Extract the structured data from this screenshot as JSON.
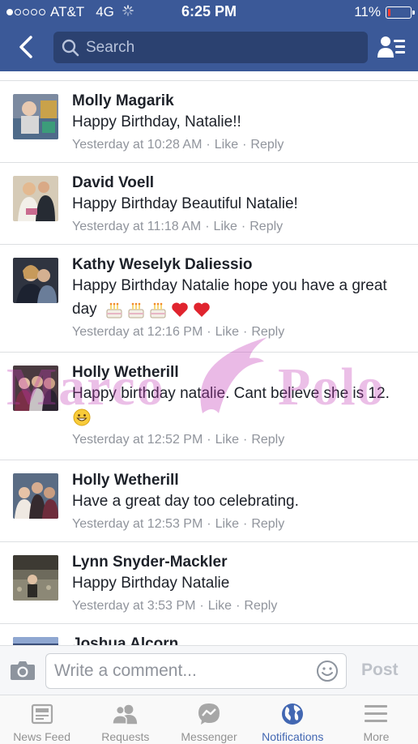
{
  "status_bar": {
    "carrier": "AT&T",
    "network": "4G",
    "time": "6:25 PM",
    "battery": "11%",
    "battery_level": 0.11
  },
  "header": {
    "back_icon": "chevron-left-icon",
    "search_placeholder": "Search",
    "friends_icon": "friends-list-icon"
  },
  "comments": [
    {
      "author": "Molly Magarik",
      "text": "Happy Birthday, Natalie!!",
      "time": "Yesterday at 10:28 AM",
      "like": "Like",
      "reply": "Reply",
      "emojis": []
    },
    {
      "author": "David Voell",
      "text": "Happy Birthday Beautiful Natalie!",
      "time": "Yesterday at 11:18 AM",
      "like": "Like",
      "reply": "Reply",
      "emojis": []
    },
    {
      "author": "Kathy Weselyk Daliessio",
      "text": "Happy Birthday Natalie hope you have a great day",
      "time": "Yesterday at 12:16 PM",
      "like": "Like",
      "reply": "Reply",
      "emojis": [
        "birthday-cake",
        "birthday-cake",
        "birthday-cake",
        "red-heart",
        "red-heart"
      ]
    },
    {
      "author": "Holly Wetherill",
      "text": "Happy birthday natalie. Cant believe she is 12.",
      "time": "Yesterday at 12:52 PM",
      "like": "Like",
      "reply": "Reply",
      "emojis": [
        "grinning-face"
      ]
    },
    {
      "author": "Holly Wetherill",
      "text": "Have a great day too celebrating.",
      "time": "Yesterday at 12:53 PM",
      "like": "Like",
      "reply": "Reply",
      "emojis": []
    },
    {
      "author": "Lynn Snyder-Mackler",
      "text": "Happy Birthday Natalie",
      "time": "Yesterday at 3:53 PM",
      "like": "Like",
      "reply": "Reply",
      "emojis": []
    },
    {
      "author": "Joshua Alcorn",
      "text": "",
      "time": "",
      "like": "",
      "reply": "",
      "emojis": []
    }
  ],
  "watermark": {
    "left": "Marco",
    "right": "Polo"
  },
  "composer": {
    "camera_icon": "camera-icon",
    "placeholder": "Write a comment...",
    "emoji_icon": "smiley-icon",
    "post_label": "Post"
  },
  "tabs": [
    {
      "label": "News Feed",
      "icon": "news-feed-icon",
      "active": false
    },
    {
      "label": "Requests",
      "icon": "friend-requests-icon",
      "active": false
    },
    {
      "label": "Messenger",
      "icon": "messenger-icon",
      "active": false
    },
    {
      "label": "Notifications",
      "icon": "globe-icon",
      "active": true
    },
    {
      "label": "More",
      "icon": "hamburger-menu-icon",
      "active": false
    }
  ],
  "colors": {
    "header_blue": "#3b5998",
    "search_bg": "#2b4170",
    "meta_gray": "#90949c",
    "active_tab": "#4267b2",
    "battery_low": "#ff3b30"
  }
}
